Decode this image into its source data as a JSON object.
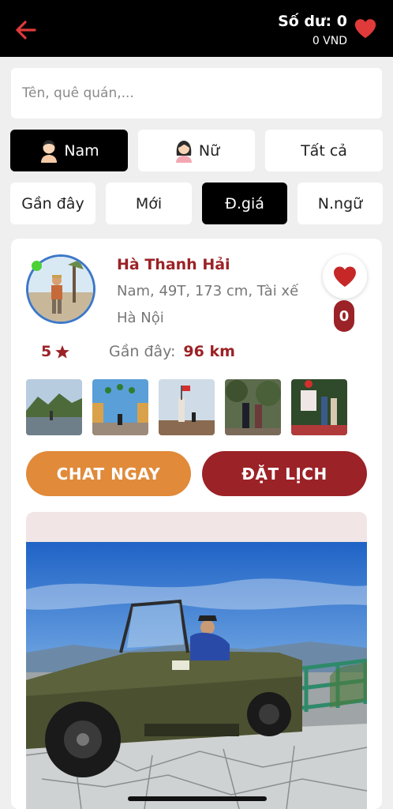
{
  "header": {
    "balance_label": "Số dư: 0",
    "balance_vnd": "0 VND",
    "accent_color": "#e03a3a"
  },
  "search": {
    "placeholder": "Tên, quê quán,..."
  },
  "gender_filters": [
    {
      "label": "Nam",
      "icon": "male-avatar-icon",
      "active": true
    },
    {
      "label": "Nữ",
      "icon": "female-avatar-icon",
      "active": false
    },
    {
      "label": "Tất cả",
      "active": false
    }
  ],
  "sort_filters": [
    {
      "label": "Gần đây",
      "active": false
    },
    {
      "label": "Mới",
      "active": false
    },
    {
      "label": "Đ.giá",
      "active": true
    },
    {
      "label": "N.ngữ",
      "active": false
    }
  ],
  "profile": {
    "name": "Hà Thanh Hải",
    "info": "Nam, 49T, 173 cm, Tài xế",
    "city": "Hà Nội",
    "likes": "0",
    "rating": "5",
    "distance_label": "Gần đây:",
    "distance_value": "96 km",
    "online": true
  },
  "actions": {
    "chat_label": "CHAT NGAY",
    "book_label": "ĐẶT LỊCH"
  },
  "colors": {
    "brand_red": "#9b2226",
    "chat_orange": "#e08a3a",
    "online_green": "#4cd137"
  }
}
